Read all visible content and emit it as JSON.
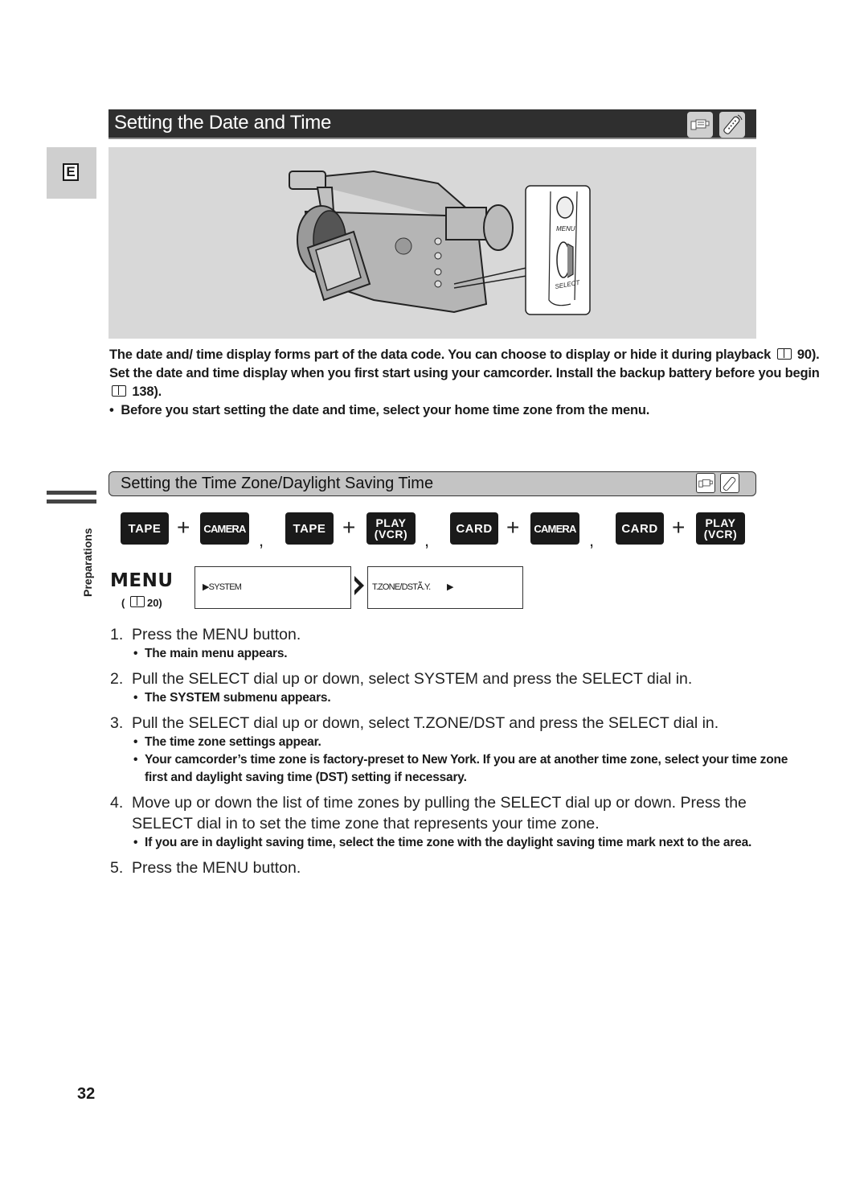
{
  "page": {
    "title": "Setting the Date and Time",
    "language_tab": "E",
    "page_number": "32",
    "side_label": "Preparations",
    "header_icons": [
      "camcorder-icon",
      "remote-control-icon"
    ]
  },
  "illustration": {
    "labels": {
      "menu": "MENU",
      "select": "SELECT"
    }
  },
  "intro": {
    "line1_text": "The date and/ time display forms part of the data code. You can choose to display or hide it during playback",
    "line1_ref": "90).",
    "line2_text": "Set the date and time display when you first start using your camcorder. Install the backup battery before you begin",
    "line2_ref": "138).",
    "bullet": "Before you start setting the date and time, select your home time zone from the menu."
  },
  "section": {
    "title": "Setting the Time Zone/Daylight Saving Time"
  },
  "modes": [
    {
      "a": "TAPE",
      "b": "CAMERA"
    },
    {
      "a": "TAPE",
      "b_line1": "PLAY",
      "b_line2": "(VCR)"
    },
    {
      "a": "CARD",
      "b": "CAMERA"
    },
    {
      "a": "CARD",
      "b_line1": "PLAY",
      "b_line2": "(VCR)"
    }
  ],
  "mode_symbols": {
    "plus": "+",
    "comma": ","
  },
  "menu": {
    "label": "MENU",
    "ref": "20)",
    "ref_open": "(",
    "box1": "▶SYSTEM",
    "box2": "T.ZONE/DSTÃ̃.Y.",
    "box2_arrow": "▶"
  },
  "steps": [
    {
      "num": "1.",
      "text": "Press the MENU button.",
      "notes": [
        "The main menu appears."
      ]
    },
    {
      "num": "2.",
      "text": "Pull the SELECT dial up or down, select SYSTEM and press the SELECT dial in.",
      "notes": [
        "The SYSTEM submenu appears."
      ]
    },
    {
      "num": "3.",
      "text": "Pull the SELECT dial up or down, select T.ZONE/DST and press the SELECT dial in.",
      "notes": [
        "The time zone settings appear.",
        "Your camcorder’s time zone is factory-preset to New York. If you are at another time zone, select your time zone first and daylight saving time (DST) setting if necessary."
      ]
    },
    {
      "num": "4.",
      "text": "Move up or down the list of time zones by pulling the SELECT dial up or down. Press the SELECT dial in to set the time zone that represents your time zone.",
      "notes": [
        "If you are in daylight saving time, select the time zone with the daylight saving time mark next to the area."
      ]
    },
    {
      "num": "5.",
      "text": "Press the MENU button.",
      "notes": []
    }
  ],
  "bullet_char": "•"
}
